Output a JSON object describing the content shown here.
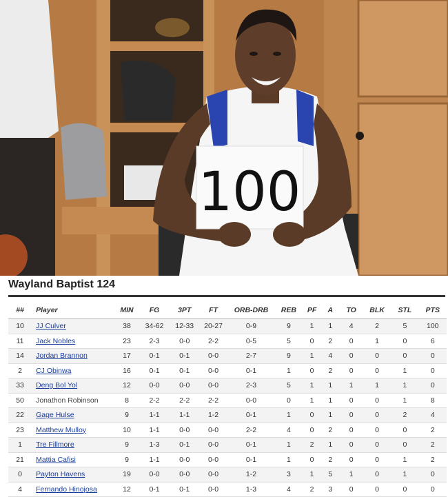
{
  "sign": {
    "text": "100"
  },
  "box_score": {
    "team_title": "Wayland Baptist 124",
    "columns": [
      "##",
      "Player",
      "MIN",
      "FG",
      "3PT",
      "FT",
      "ORB-DRB",
      "REB",
      "PF",
      "A",
      "TO",
      "BLK",
      "STL",
      "PTS"
    ],
    "rows": [
      {
        "num": "10",
        "player": "JJ Culver",
        "link": true,
        "min": "38",
        "fg": "34-62",
        "tpt": "12-33",
        "ft": "20-27",
        "orbdrb": "0-9",
        "reb": "9",
        "pf": "1",
        "a": "1",
        "to": "4",
        "blk": "2",
        "stl": "5",
        "pts": "100"
      },
      {
        "num": "11",
        "player": "Jack Nobles",
        "link": true,
        "min": "23",
        "fg": "2-3",
        "tpt": "0-0",
        "ft": "2-2",
        "orbdrb": "0-5",
        "reb": "5",
        "pf": "0",
        "a": "2",
        "to": "0",
        "blk": "1",
        "stl": "0",
        "pts": "6"
      },
      {
        "num": "14",
        "player": "Jordan Brannon",
        "link": true,
        "min": "17",
        "fg": "0-1",
        "tpt": "0-1",
        "ft": "0-0",
        "orbdrb": "2-7",
        "reb": "9",
        "pf": "1",
        "a": "4",
        "to": "0",
        "blk": "0",
        "stl": "0",
        "pts": "0"
      },
      {
        "num": "2",
        "player": "CJ Obinwa",
        "link": true,
        "min": "16",
        "fg": "0-1",
        "tpt": "0-1",
        "ft": "0-0",
        "orbdrb": "0-1",
        "reb": "1",
        "pf": "0",
        "a": "2",
        "to": "0",
        "blk": "0",
        "stl": "1",
        "pts": "0"
      },
      {
        "num": "33",
        "player": "Deng Bol Yol",
        "link": true,
        "min": "12",
        "fg": "0-0",
        "tpt": "0-0",
        "ft": "0-0",
        "orbdrb": "2-3",
        "reb": "5",
        "pf": "1",
        "a": "1",
        "to": "1",
        "blk": "1",
        "stl": "1",
        "pts": "0"
      },
      {
        "num": "50",
        "player": "Jonathon Robinson",
        "link": false,
        "min": "8",
        "fg": "2-2",
        "tpt": "2-2",
        "ft": "2-2",
        "orbdrb": "0-0",
        "reb": "0",
        "pf": "1",
        "a": "1",
        "to": "0",
        "blk": "0",
        "stl": "1",
        "pts": "8"
      },
      {
        "num": "22",
        "player": "Gage Hulse",
        "link": true,
        "min": "9",
        "fg": "1-1",
        "tpt": "1-1",
        "ft": "1-2",
        "orbdrb": "0-1",
        "reb": "1",
        "pf": "0",
        "a": "1",
        "to": "0",
        "blk": "0",
        "stl": "2",
        "pts": "4"
      },
      {
        "num": "23",
        "player": "Matthew Mulloy",
        "link": true,
        "min": "10",
        "fg": "1-1",
        "tpt": "0-0",
        "ft": "0-0",
        "orbdrb": "2-2",
        "reb": "4",
        "pf": "0",
        "a": "2",
        "to": "0",
        "blk": "0",
        "stl": "0",
        "pts": "2"
      },
      {
        "num": "1",
        "player": "Tre Fillmore",
        "link": true,
        "min": "9",
        "fg": "1-3",
        "tpt": "0-1",
        "ft": "0-0",
        "orbdrb": "0-1",
        "reb": "1",
        "pf": "2",
        "a": "1",
        "to": "0",
        "blk": "0",
        "stl": "0",
        "pts": "2"
      },
      {
        "num": "21",
        "player": "Mattia Cafisi",
        "link": true,
        "min": "9",
        "fg": "1-1",
        "tpt": "0-0",
        "ft": "0-0",
        "orbdrb": "0-1",
        "reb": "1",
        "pf": "0",
        "a": "2",
        "to": "0",
        "blk": "0",
        "stl": "1",
        "pts": "2"
      },
      {
        "num": "0",
        "player": "Payton Havens",
        "link": true,
        "min": "19",
        "fg": "0-0",
        "tpt": "0-0",
        "ft": "0-0",
        "orbdrb": "1-2",
        "reb": "3",
        "pf": "1",
        "a": "5",
        "to": "1",
        "blk": "0",
        "stl": "1",
        "pts": "0"
      },
      {
        "num": "4",
        "player": "Fernando Hinojosa",
        "link": true,
        "min": "12",
        "fg": "0-1",
        "tpt": "0-1",
        "ft": "0-0",
        "orbdrb": "1-3",
        "reb": "4",
        "pf": "2",
        "a": "3",
        "to": "0",
        "blk": "0",
        "stl": "0",
        "pts": "0"
      }
    ]
  }
}
